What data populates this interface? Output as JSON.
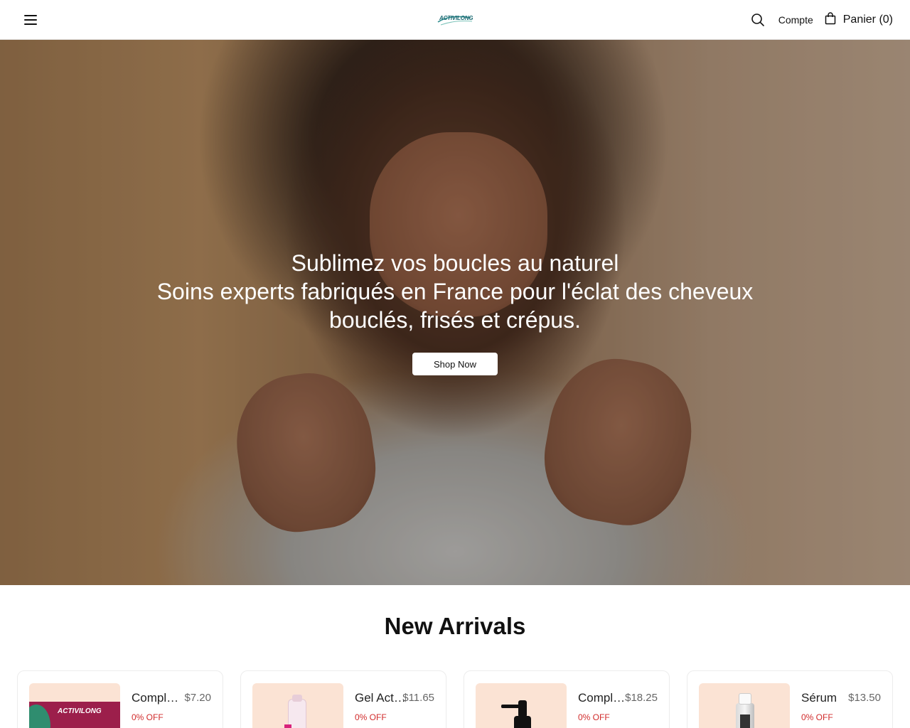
{
  "header": {
    "logo_text": "ACTIVILONG",
    "account_label": "Compte",
    "cart_label": "Panier (0)"
  },
  "hero": {
    "title": "Sublimez vos boucles au naturel",
    "subtitle": "Soins experts fabriqués en France pour l'éclat des cheveux bouclés, frisés et crépus.",
    "cta_label": "Shop Now"
  },
  "section": {
    "title": "New Arrivals"
  },
  "products": [
    {
      "name": "Complément",
      "price": "$7.20",
      "discount": "0% OFF"
    },
    {
      "name": "Gel Activilong",
      "price": "$11.65",
      "discount": "0% OFF"
    },
    {
      "name": "Complexe",
      "price": "$18.25",
      "discount": "0% OFF"
    },
    {
      "name": "Sérum",
      "price": "$13.50",
      "discount": "0% OFF"
    }
  ],
  "colors": {
    "accent_logo": "#1d6a73",
    "discount_red": "#d12b2b",
    "thumb_bg": "#fbe3d4"
  },
  "icons": [
    "menu-icon",
    "search-icon",
    "shopping-bag-icon"
  ]
}
